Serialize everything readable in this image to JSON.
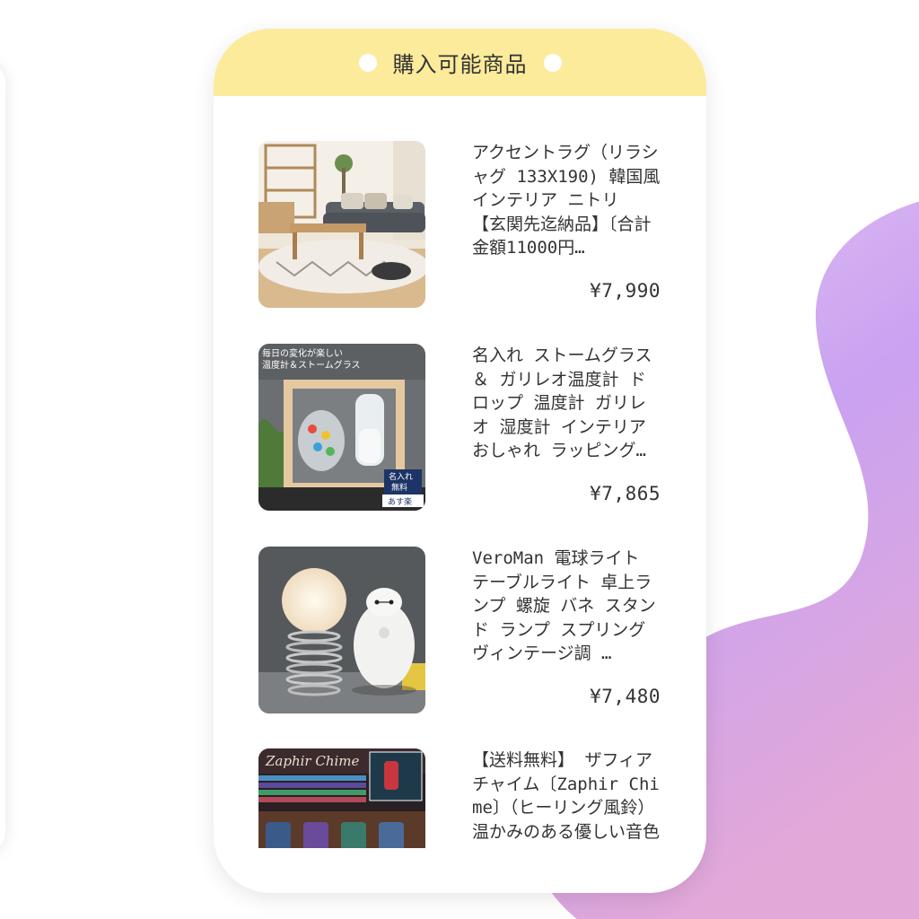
{
  "header": {
    "title": "購入可能商品"
  },
  "colors": {
    "header_bg": "#fbeb9b",
    "blob_top": "#e9c6f2",
    "blob_mid": "#c9a2f1",
    "blob_bottom": "#e2a8d8"
  },
  "products": [
    {
      "name": "アクセントラグ（リラシャグ 133X190) 韓国風インテリア ニトリ 【玄関先迄納品】〔合計金額11000円…",
      "price": "¥7,990",
      "image_icon": "living-room-rug-photo"
    },
    {
      "name": "名入れ ストームグラス ＆ ガリレオ温度計 ドロップ 温度計 ガリレオ 湿度計 インテリア おしゃれ ラッピング…",
      "price": "¥7,865",
      "image_icon": "storm-glass-thermometer-photo",
      "image_texts": {
        "caption": "毎日の変化が楽しい温度計＆ストームグラス",
        "badge": "名入れ無料",
        "tag": "あす楽"
      }
    },
    {
      "name": "VeroMan 電球ライト テーブルライト 卓上ランプ 螺旋 バネ スタンド ランプ スプリング ヴィンテージ調 …",
      "price": "¥7,480",
      "image_icon": "spring-lamp-photo"
    },
    {
      "name": "【送料無料】 ザフィアチャイム〔Zaphir Chime〕（ヒーリング風鈴）温かみのある優しい音色",
      "price": "",
      "image_icon": "zaphir-chime-photo",
      "image_texts": {
        "title": "Zaphir Chime"
      }
    }
  ]
}
